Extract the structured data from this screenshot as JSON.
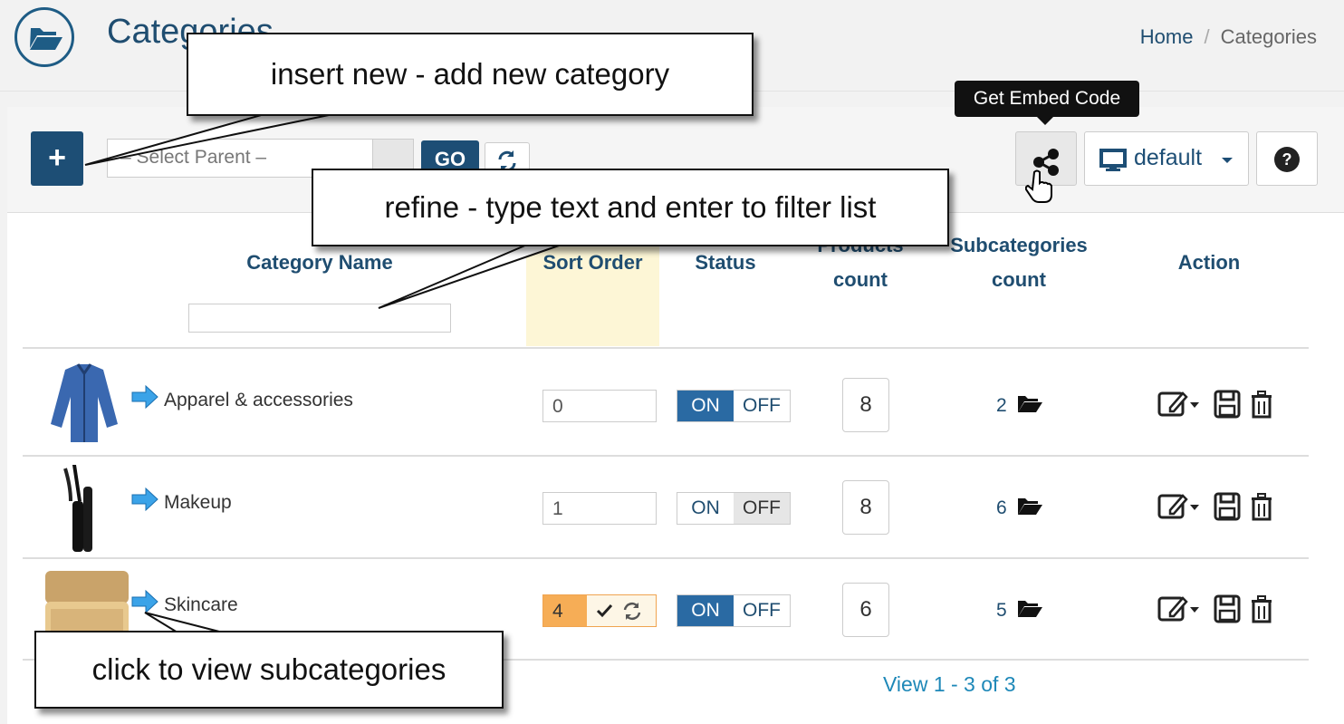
{
  "header": {
    "title": "Categories",
    "breadcrumb": {
      "home": "Home",
      "separator": "/",
      "current": "Categories"
    }
  },
  "toolbar": {
    "add_label": "+",
    "parent_select_placeholder": "– Select Parent –",
    "go_label": "GO",
    "view_label": "default",
    "tooltip": "Get Embed Code"
  },
  "table": {
    "columns": {
      "name": "Category Name",
      "sort": "Sort Order",
      "status": "Status",
      "products_line1": "Products",
      "products_line2": "count",
      "subcats_line1": "Subcategories",
      "subcats_line2": "count",
      "action": "Action"
    },
    "rows": [
      {
        "name": "Apparel & accessories",
        "sort": "0",
        "status": "ON",
        "on": "ON",
        "off": "OFF",
        "products": "8",
        "subcategories": "2"
      },
      {
        "name": "Makeup",
        "sort": "1",
        "status": "OFF",
        "on": "ON",
        "off": "OFF",
        "products": "8",
        "subcategories": "6"
      },
      {
        "name": "Skincare",
        "sort": "4",
        "status": "ON",
        "on": "ON",
        "off": "OFF",
        "products": "6",
        "subcategories": "5"
      }
    ],
    "pager": "View 1 - 3 of 3"
  },
  "callouts": {
    "insert": "insert new - add new category",
    "refine": "refine - type text and enter to filter list",
    "view_sub": "click to view subcategories"
  },
  "colors": {
    "primary": "#1d4e75",
    "accent": "#2a6aa3",
    "highlight": "#f6ad56",
    "link": "#1e88b8"
  }
}
